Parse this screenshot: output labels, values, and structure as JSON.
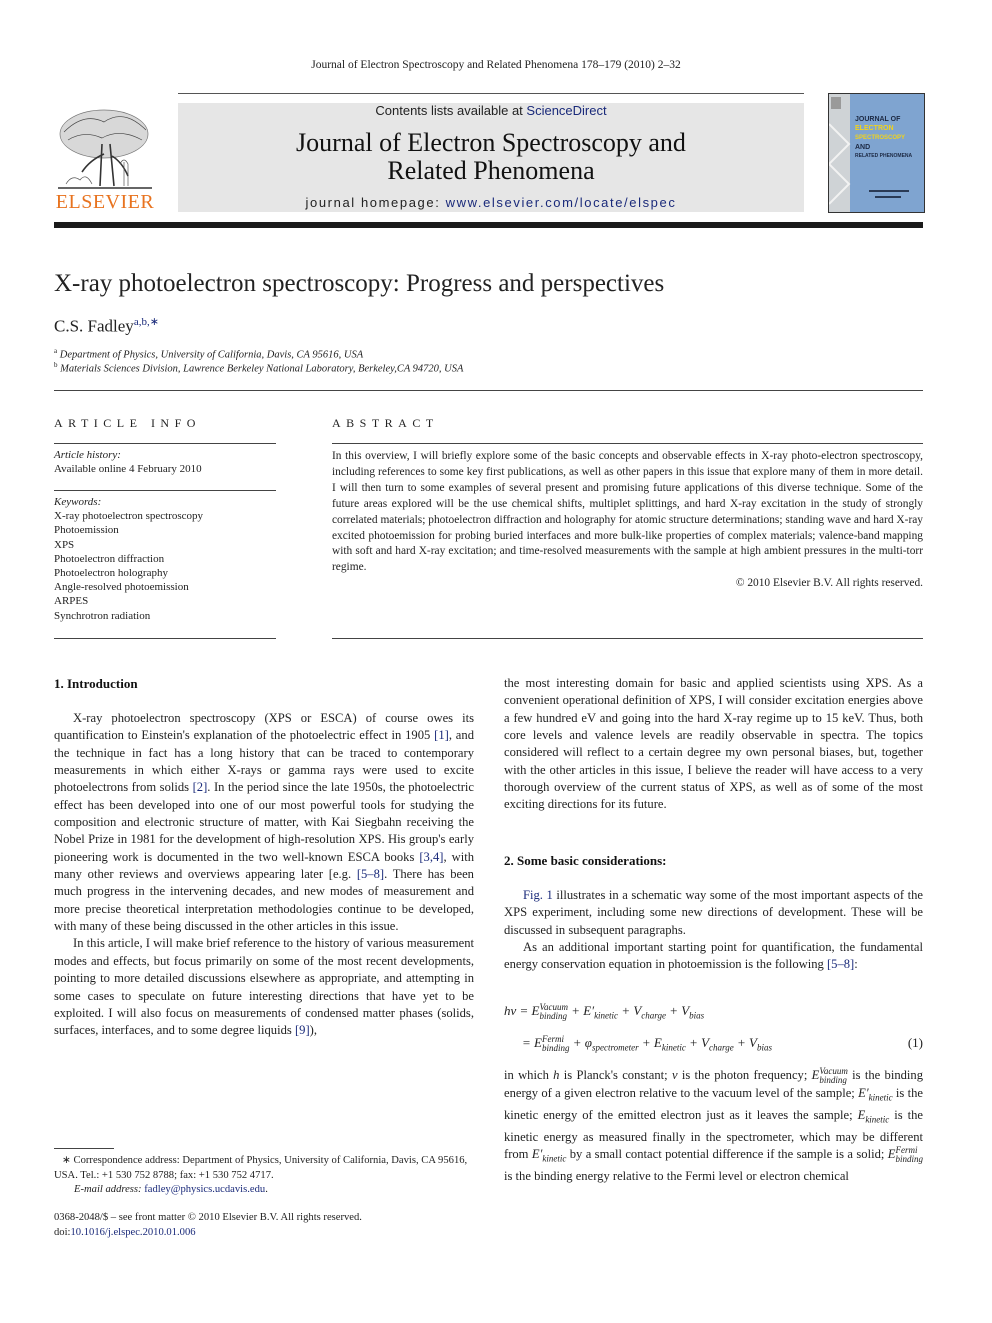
{
  "running_head": "Journal of Electron Spectroscopy and Related Phenomena 178–179 (2010) 2–32",
  "masthead": {
    "contents_prefix": "Contents lists available at ",
    "contents_link": "ScienceDirect",
    "journal_title_line1": "Journal of Electron Spectroscopy and",
    "journal_title_line2": "Related Phenomena",
    "homepage_prefix": "journal homepage: ",
    "homepage_url": "www.elsevier.com/locate/elspec",
    "publisher_logo_text": "ELSEVIER",
    "cover_lines": [
      "JOURNAL OF",
      "ELECTRON",
      "SPECTROSCOPY",
      "AND",
      "RELATED PHENOMENA"
    ]
  },
  "article": {
    "title": "X-ray photoelectron spectroscopy: Progress and perspectives",
    "author": "C.S. Fadley",
    "author_marks": "a,b,∗",
    "affiliations": [
      {
        "mark": "a",
        "text": "Department of Physics, University of California, Davis, CA 95616, USA"
      },
      {
        "mark": "b",
        "text": "Materials Sciences Division, Lawrence Berkeley National Laboratory, Berkeley,CA 94720, USA"
      }
    ]
  },
  "article_info": {
    "heading": "ARTICLE INFO",
    "history_label": "Article history:",
    "history_value": "Available online 4 February 2010",
    "keywords_label": "Keywords:",
    "keywords": [
      "X-ray photoelectron spectroscopy",
      "Photoemission",
      "XPS",
      "Photoelectron diffraction",
      "Photoelectron holography",
      "Angle-resolved photoemission",
      "ARPES",
      "Synchrotron radiation"
    ]
  },
  "abstract": {
    "heading": "ABSTRACT",
    "text": "In this overview, I will briefly explore some of the basic concepts and observable effects in X-ray photo-electron spectroscopy, including references to some key first publications, as well as other papers in this issue that explore many of them in more detail. I will then turn to some examples of several present and promising future applications of this diverse technique. Some of the future areas explored will be the use chemical shifts, multiplet splittings, and hard X-ray excitation in the study of strongly correlated materials; photoelectron diffraction and holography for atomic structure determinations; standing wave and hard X-ray excited photoemission for probing buried interfaces and more bulk-like properties of complex materials; valence-band mapping with soft and hard X-ray excitation; and time-resolved measurements with the sample at high ambient pressures in the multi-torr regime.",
    "copyright": "© 2010 Elsevier B.V. All rights reserved."
  },
  "body": {
    "section1_heading": "1.  Introduction",
    "p1": {
      "t1": "X-ray photoelectron spectroscopy (XPS or ESCA) of course owes its quantification to Einstein's explanation of the photoelectric effect in 1905 ",
      "r1": "[1]",
      "t2": ", and the technique in fact has a long history that can be traced to contemporary measurements in which either X-rays or gamma rays were used to excite photoelectrons from solids ",
      "r2": "[2]",
      "t3": ". In the period since the late 1950s, the photoelectric effect has been developed into one of our most powerful tools for studying the composition and electronic structure of matter, with Kai Siegbahn receiving the Nobel Prize in 1981 for the development of high-resolution XPS. His group's early pioneering work is documented in the two well-known ESCA books ",
      "r3": "[3,4]",
      "t4": ", with many other reviews and overviews appearing later [e.g. ",
      "r4": "[5–8]",
      "t5": ". There has been much progress in the intervening decades, and new modes of measurement and more precise theoretical interpretation methodologies continue to be developed, with many of these being discussed in the other articles in this issue."
    },
    "p2": {
      "t1": "In this article, I will make brief reference to the history of various measurement modes and effects, but focus primarily on some of the most recent developments, pointing to more detailed discussions elsewhere as appropriate, and attempting in some cases to speculate on future interesting directions that have yet to be exploited. I will also focus on measurements of condensed matter phases (solids, surfaces, interfaces, and to some degree liquids ",
      "r1": "[9]",
      "t2": "),"
    },
    "p3": "the most interesting domain for basic and applied scientists using XPS. As a convenient operational definition of XPS, I will consider excitation energies above a few hundred eV and going into the hard X-ray regime up to 15 keV. Thus, both core levels and valence levels are readily observable in spectra. The topics considered will reflect to a certain degree my own personal biases, but, together with the other articles in this issue, I believe the reader will have access to a very thorough overview of the current status of XPS, as well as of some of the most exciting directions for its future.",
    "section2_heading": "2.  Some basic considerations:",
    "p4": {
      "r1": "Fig. 1",
      "t1": " illustrates in a schematic way some of the most important aspects of the XPS experiment, including some new directions of development. These will be discussed in subsequent paragraphs."
    },
    "p5": {
      "t1": "As an additional important starting point for quantification, the fundamental energy conservation equation in photoemission is the following ",
      "r1": "[5–8]",
      "t2": ":"
    },
    "equation": {
      "lhs": "hν",
      "vacuum": "Vacuum",
      "binding": "binding",
      "fermi": "Fermi",
      "kinetic": "kinetic",
      "charge": "charge",
      "bias": "bias",
      "spectrometer": "spectrometer",
      "number": "(1)"
    },
    "p6": {
      "t1": "in which ",
      "h": "h",
      "t2": " is Planck's constant; ",
      "nu": "ν",
      "t3": " is the photon frequency; ",
      "t4": " is the binding energy of a given electron relative to the vacuum level of the sample; ",
      "t5": " is the kinetic energy of the emitted electron just as it leaves the sample; ",
      "t6": " is the kinetic energy as measured finally in the spectrometer, which may be different from ",
      "t7": " by a small contact potential difference if the sample is a solid; ",
      "t8": " is the binding energy relative to the Fermi level or electron chemical"
    }
  },
  "footnotes": {
    "correspondence": "∗  Correspondence address: Department of Physics, University of California, Davis, CA 95616, USA. Tel.: +1 530 752 8788; fax: +1 530 752 4717.",
    "email_label": "E-mail address: ",
    "email": "fadley@physics.ucdavis.edu",
    "email_end": ".",
    "front_matter": "0368-2048/$ – see front matter © 2010 Elsevier B.V. All rights reserved.",
    "doi_label": "doi:",
    "doi": "10.1016/j.elspec.2010.01.006"
  }
}
